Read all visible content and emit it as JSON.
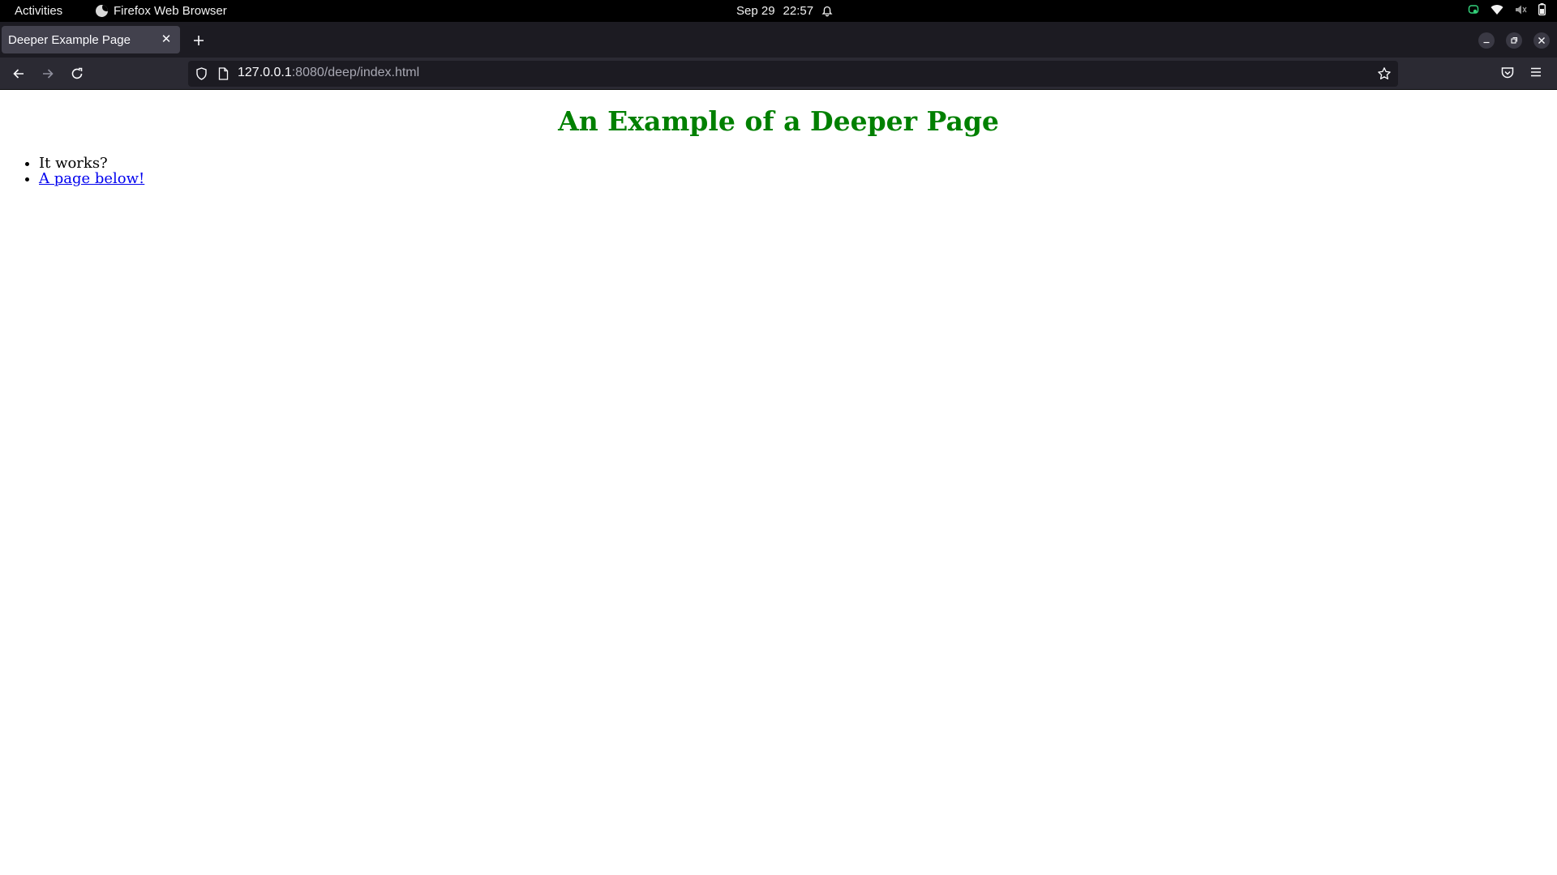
{
  "topbar": {
    "activities": "Activities",
    "app_name": "Firefox Web Browser",
    "date": "Sep 29",
    "time": "22:57"
  },
  "browser": {
    "tab_title": "Deeper Example Page",
    "url_host": "127.0.0.1",
    "url_rest": ":8080/deep/index.html"
  },
  "page": {
    "heading": "An Example of a Deeper Page",
    "items": [
      {
        "text": "It works?"
      },
      {
        "text": "A page below!"
      }
    ],
    "heading_color": "#008000",
    "link_color": "#0000ee"
  }
}
